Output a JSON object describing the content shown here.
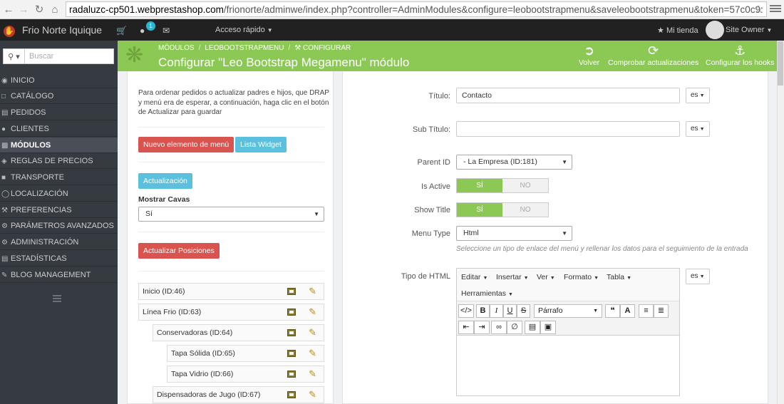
{
  "browser": {
    "url_domain": "radaluzc-cp501.webprestashop.com",
    "url_path": "/frionorte/adminwe/index.php?controller=AdminModules&configure=leobootstrapmenu&saveleobootstrapmenu&token=57c0c9:"
  },
  "topnav": {
    "shop_name": "Frio Norte Iquique",
    "notifications_count": "1",
    "quick_access": "Acceso rápido",
    "my_store": "Mi tienda",
    "owner": "Site Owner"
  },
  "sidebar": {
    "search_placeholder": "Buscar",
    "items": [
      {
        "label": "INICIO",
        "icon": "dashboard-icon"
      },
      {
        "label": "CATÁLOGO",
        "icon": "catalog-icon"
      },
      {
        "label": "PEDIDOS",
        "icon": "orders-icon"
      },
      {
        "label": "CLIENTES",
        "icon": "customers-icon"
      },
      {
        "label": "MÓDULOS",
        "icon": "modules-icon"
      },
      {
        "label": "REGLAS DE PRECIOS",
        "icon": "tag-icon"
      },
      {
        "label": "TRANSPORTE",
        "icon": "truck-icon"
      },
      {
        "label": "LOCALIZACIÓN",
        "icon": "globe-icon"
      },
      {
        "label": "PREFERENCIAS",
        "icon": "wrench-icon"
      },
      {
        "label": "PARÁMETROS AVANZADOS",
        "icon": "cogs-icon"
      },
      {
        "label": "ADMINISTRACIÓN",
        "icon": "cog-icon"
      },
      {
        "label": "ESTADÍSTICAS",
        "icon": "stats-icon"
      },
      {
        "label": "BLOG MANAGEMENT",
        "icon": "pencil-icon"
      }
    ]
  },
  "header": {
    "breadcrumb": [
      "MÓDULOS",
      "LEOBOOTSTRAPMENU",
      "CONFIGURAR"
    ],
    "title": "Configurar \"Leo Bootstrap Megamenu\" módulo",
    "back": "Volver",
    "check_updates": "Comprobar actualizaciones",
    "hooks": "Configurar los hooks"
  },
  "left": {
    "help": "Para ordenar pedidos o actualizar padres e hijos, que DRAP y menú era de esperar, a continuación, haga clic en el botón de Actualizar para guardar",
    "new_item": "Nuevo elemento de menú",
    "widget_list": "Lista Widget",
    "update": "Actualización",
    "show_cavas_label": "Mostrar Cavas",
    "show_cavas_value": "Sí",
    "update_positions": "Actualizar Posiciones",
    "tree": [
      "Inicio (ID:46)",
      "Línea Frio (ID:63)",
      "Conservadoras (ID:64)",
      "Tapa Sólida (ID:65)",
      "Tapa Vidrio (ID:66)",
      "Dispensadoras de Jugo (ID:67)"
    ]
  },
  "form": {
    "title_label": "Título:",
    "title_value": "Contacto",
    "subtitle_label": "Sub Título:",
    "subtitle_value": "",
    "lang": "es",
    "parent_label": "Parent ID",
    "parent_value": "- La Empresa (ID:181)",
    "active_label": "Is Active",
    "showtitle_label": "Show Title",
    "yes": "SÍ",
    "no": "NO",
    "menutype_label": "Menu Type",
    "menutype_value": "Html",
    "menutype_help": "Seleccione un tipo de enlace del menú y rellenar los datos para el seguimiento de la entrada",
    "html_label": "Tipo de HTML"
  },
  "editor": {
    "menus": [
      "Editar",
      "Insertar",
      "Ver",
      "Formato",
      "Tabla",
      "Herramientas"
    ],
    "format_value": "Párrafo"
  }
}
